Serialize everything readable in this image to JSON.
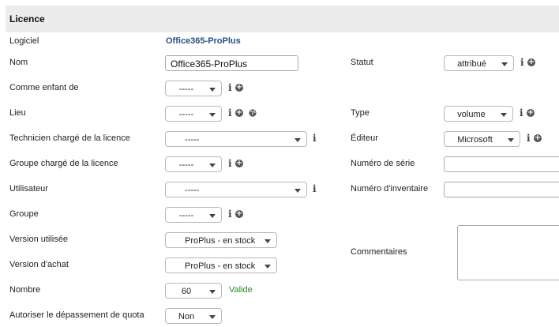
{
  "section_title": "Licence",
  "left": {
    "logiciel": {
      "label": "Logiciel",
      "value": "Office365-ProPlus"
    },
    "nom": {
      "label": "Nom",
      "value": "Office365-ProPlus"
    },
    "comme_enfant": {
      "label": "Comme enfant de",
      "value": "-----"
    },
    "lieu": {
      "label": "Lieu",
      "value": "-----"
    },
    "technicien": {
      "label": "Technicien chargé de la licence",
      "value": "-----"
    },
    "groupe_charge": {
      "label": "Groupe chargé de la licence",
      "value": "-----"
    },
    "utilisateur": {
      "label": "Utilisateur",
      "value": "-----"
    },
    "groupe": {
      "label": "Groupe",
      "value": "-----"
    },
    "version_utilisee": {
      "label": "Version utilisée",
      "value": "ProPlus - en stock"
    },
    "version_achat": {
      "label": "Version d'achat",
      "value": "ProPlus - en stock"
    },
    "nombre": {
      "label": "Nombre",
      "value": "60",
      "status": "Valide"
    },
    "quota": {
      "label": "Autoriser le dépassement de quota",
      "value": "Non"
    }
  },
  "right": {
    "statut": {
      "label": "Statut",
      "value": "attribué"
    },
    "type": {
      "label": "Type",
      "value": "volume"
    },
    "editeur": {
      "label": "Éditeur",
      "value": "Microsoft"
    },
    "serie": {
      "label": "Numéro de série",
      "value": ""
    },
    "inventaire": {
      "label": "Numéro d'inventaire",
      "value": ""
    },
    "commentaires": {
      "label": "Commentaires",
      "value": ""
    }
  },
  "icons": {
    "info": "info-icon",
    "add": "plus-circle-icon",
    "globe": "globe-icon"
  },
  "colors": {
    "header_bg": "#ececec",
    "link": "#2a4c86",
    "valid": "#2a8a2a"
  }
}
